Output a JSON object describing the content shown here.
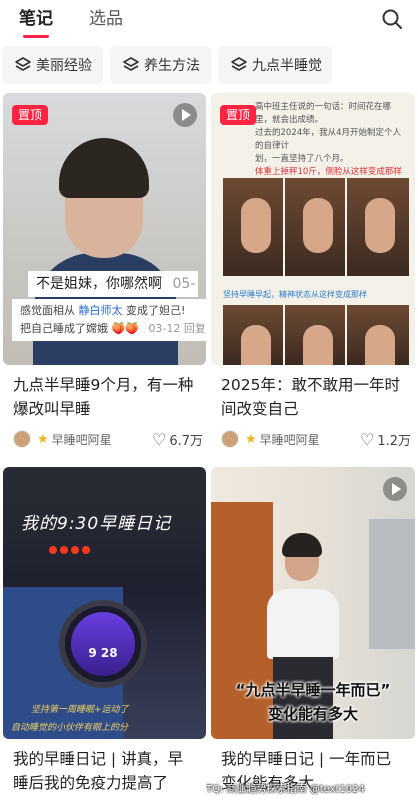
{
  "tabs": {
    "notes": "笔记",
    "picks": "选品"
  },
  "chips": [
    {
      "label": "美丽经验"
    },
    {
      "label": "养生方法"
    },
    {
      "label": "九点半睡觉"
    }
  ],
  "colors": {
    "accent": "#ff2442",
    "link": "#2a6bd6",
    "star": "#f5b21b"
  },
  "icons": {
    "search": "search-icon",
    "chip": "layers-icon",
    "play": "play-icon",
    "heart": "heart-icon",
    "star": "star-icon"
  },
  "cards": [
    {
      "badge": "置顶",
      "overlay_line1": "不是姐妹，你哪然啊",
      "overlay_line1_suffix": "05-",
      "overlay_line2_prefix": "感觉面相从",
      "overlay_line2_name": "静白师太",
      "overlay_line2_suffix": "变成了妲己!",
      "overlay_line3": "把自己睡成了嫦娥 🍑🍑",
      "overlay_line3_date": "03-12 回复",
      "title": "九点半早睡9个月，有一种爆改叫早睡",
      "author": "早睡吧阿星",
      "likes": "6.7万"
    },
    {
      "badge": "置顶",
      "img_text1": "高中班主任说的一句话：时间花在哪",
      "img_text2": "里，就会出成绩。",
      "img_text3": "过去的2024年，我从4月开始制定个人的自律计",
      "img_text4": "划，一直坚持了八个月。",
      "img_text5": "体重上掉秤10斤，侧脸从这样变成那样",
      "img_caption": "坚持早睡早起，精神状态从这样变成那样",
      "title": "2025年：敢不敢用一年时间改变自己",
      "author": "早睡吧阿星",
      "likes": "1.2万"
    },
    {
      "img_title": "我的9:30早睡日记",
      "img_hand1": "坚持第一周睡眠+运动了",
      "img_hand2": "自动睡觉的小伙伴有眼上的分",
      "watch_time": "9 28",
      "title": "我的早睡日记 | 讲真，早睡后我的免疫力提高了"
    },
    {
      "img_caption1": "“九点半早睡一年而已”",
      "img_caption2": "变化能有多大",
      "title": "我的早睡日记 | 一年而已变化能有多大",
      "watermark": "TQ: 商业趋势探索指南 @text1024"
    }
  ]
}
